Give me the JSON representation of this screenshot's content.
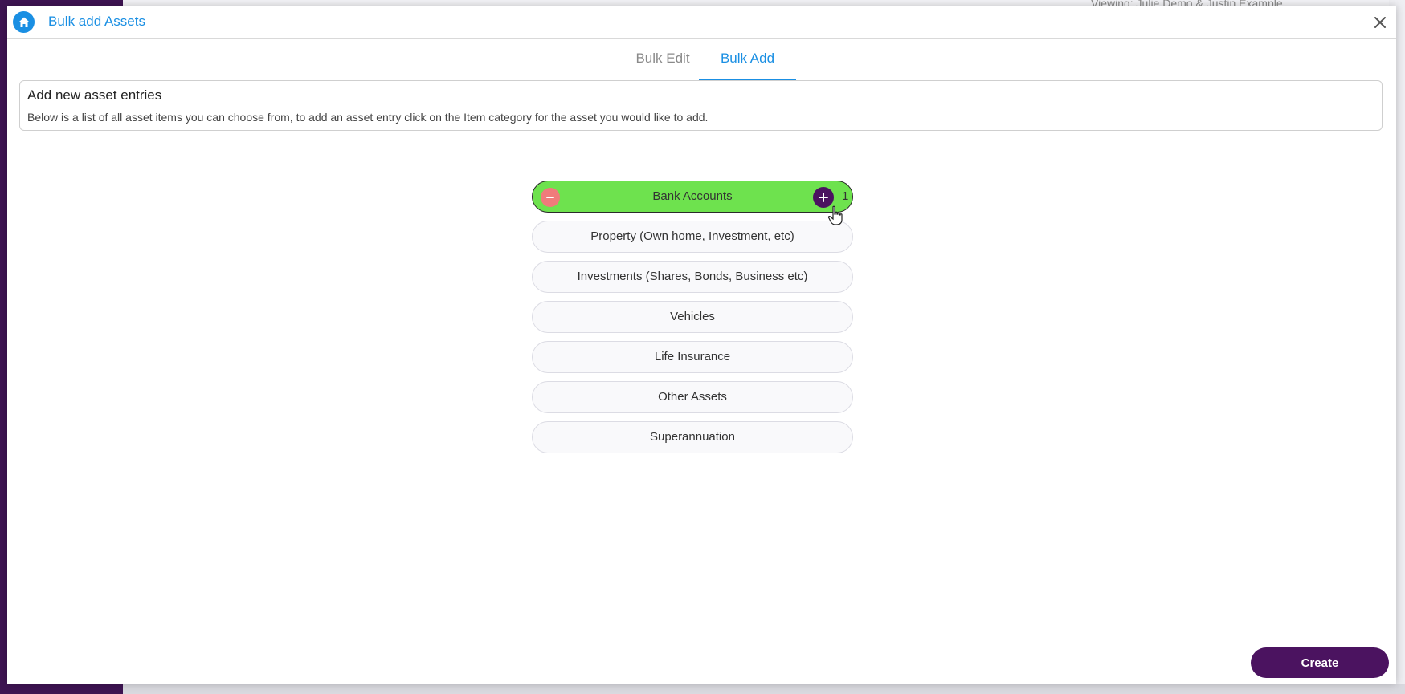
{
  "background": {
    "top_text": "Viewing: Julie Demo & Justin Example"
  },
  "modal": {
    "title": "Bulk add Assets"
  },
  "tabs": [
    {
      "label": "Bulk Edit",
      "active": false
    },
    {
      "label": "Bulk Add",
      "active": true
    }
  ],
  "info": {
    "title": "Add new asset entries",
    "description": "Below is a list of all asset items you can choose from, to add an asset entry click on the Item category for the asset you would like to add."
  },
  "categories": [
    {
      "label": "Bank Accounts",
      "count": "1",
      "active": true
    },
    {
      "label": "Property (Own home, Investment, etc)"
    },
    {
      "label": "Investments (Shares, Bonds, Business etc)"
    },
    {
      "label": "Vehicles"
    },
    {
      "label": "Life Insurance"
    },
    {
      "label": "Other Assets"
    },
    {
      "label": "Superannuation"
    }
  ],
  "footer": {
    "create_label": "Create"
  },
  "colors": {
    "accent": "#1a8fe3",
    "brand": "#4b1360",
    "active_category": "#6ee24e",
    "minus": "#f07b7b"
  },
  "icons": {
    "home": "home-icon",
    "close": "close-icon",
    "minus": "minus-icon",
    "plus": "plus-icon",
    "cursor": "hand-cursor-icon"
  }
}
